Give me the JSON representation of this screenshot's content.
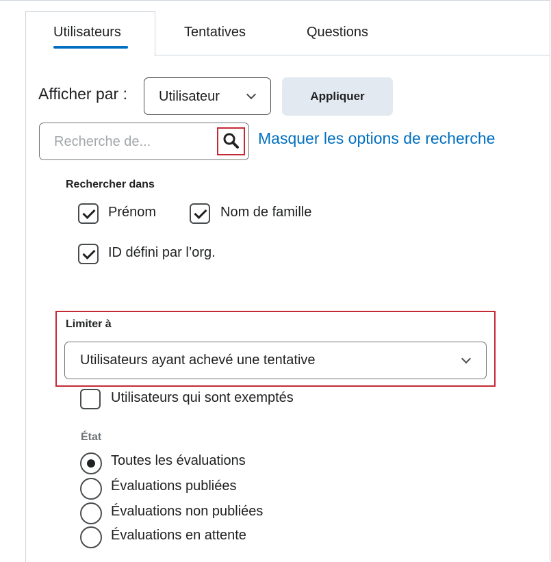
{
  "tabs": [
    {
      "label": "Utilisateurs",
      "active": true
    },
    {
      "label": "Tentatives",
      "active": false
    },
    {
      "label": "Questions",
      "active": false
    }
  ],
  "view_by": {
    "label": "Afficher par :",
    "selected": "Utilisateur"
  },
  "apply_button": "Appliquer",
  "search": {
    "placeholder": "Recherche de...",
    "toggle_link": "Masquer les options de recherche"
  },
  "search_in": {
    "heading": "Rechercher dans",
    "options": [
      {
        "label": "Prénom",
        "checked": true
      },
      {
        "label": "Nom de famille",
        "checked": true
      },
      {
        "label": "ID défini par l’org.",
        "checked": true
      }
    ]
  },
  "limit": {
    "heading": "Limiter à",
    "selected": "Utilisateurs ayant achevé une tentative",
    "exempt_option": {
      "label": "Utilisateurs qui sont exemptés",
      "checked": false
    }
  },
  "state": {
    "heading": "État",
    "options": [
      {
        "label": "Toutes les évaluations",
        "selected": true
      },
      {
        "label": "Évaluations publiées",
        "selected": false
      },
      {
        "label": "Évaluations non publiées",
        "selected": false
      },
      {
        "label": "Évaluations en attente",
        "selected": false
      }
    ]
  },
  "colors": {
    "accent": "#006fbf",
    "highlight": "#c62834",
    "button_bg": "#e3e9f1"
  },
  "icons": {
    "search": "search-icon",
    "dropdown": "chevron-down-icon"
  }
}
